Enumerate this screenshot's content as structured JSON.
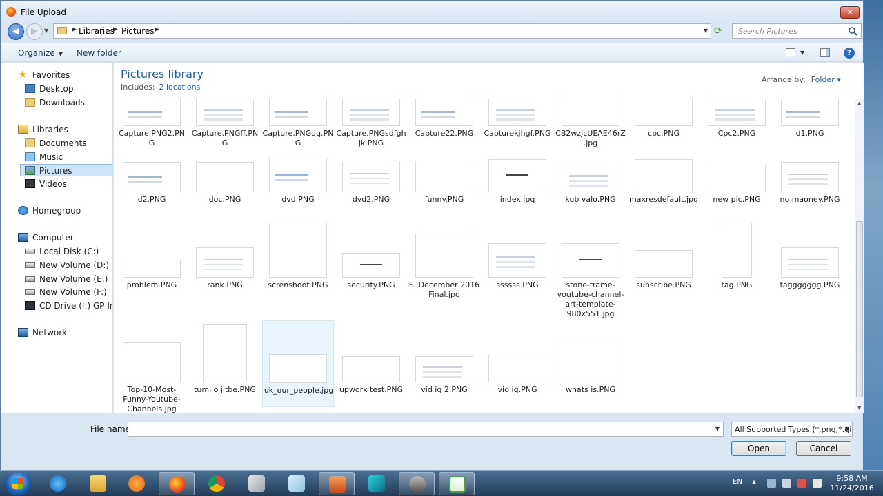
{
  "window": {
    "title": "File Upload",
    "close_label": "✕"
  },
  "address": {
    "crumbs": [
      "Libraries",
      "Pictures"
    ],
    "search_placeholder": "Search Pictures"
  },
  "toolbar": {
    "organize": "Organize",
    "new_folder": "New folder",
    "help": "?"
  },
  "nav": {
    "favorites": "Favorites",
    "desktop": "Desktop",
    "downloads": "Downloads",
    "libraries": "Libraries",
    "documents": "Documents",
    "music": "Music",
    "pictures": "Pictures",
    "videos": "Videos",
    "homegroup": "Homegroup",
    "computer": "Computer",
    "local_c": "Local Disk (C:)",
    "vol_d": "New Volume (D:)",
    "vol_e": "New Volume (E:)",
    "vol_f": "New Volume (F:)",
    "cd": "CD Drive (I:) GP Inter",
    "network": "Network"
  },
  "library": {
    "title": "Pictures library",
    "includes_label": "Includes:",
    "includes_link": "2 locations",
    "arrange_label": "Arrange by:",
    "arrange_value": "Folder"
  },
  "files": [
    "Capture.PNG2.PNG",
    "Capture.PNGff.PNG",
    "Capture.PNGqq.PNG",
    "Capture.PNGsdfghjk.PNG",
    "Capture22.PNG",
    "Capturekjhgf.PNG",
    "CB2wzjcUEAE46rZ.jpg",
    "cpc.PNG",
    "Cpc2.PNG",
    "d1.PNG",
    "d2.PNG",
    "doc.PNG",
    "dvd.PNG",
    "dvd2.PNG",
    "funny.PNG",
    "index.jpg",
    "kub valo.PNG",
    "maxresdefault.jpg",
    "new pic.PNG",
    "no maoney.PNG",
    "problem.PNG",
    "rank.PNG",
    "screnshoot.PNG",
    "security.PNG",
    "SI December 2016 Final.jpg",
    "ssssss.PNG",
    "stone-frame-youtube-channel-art-template-980x551.jpg",
    "subscribe.PNG",
    "tag.PNG",
    "taggggggg.PNG",
    "Top-10-Most-Funny-Youtube-Channels.jpg",
    "tumi o jitbe.PNG",
    "uk_our_people.jpg",
    "upwork test.PNG",
    "vid iq 2.PNG",
    "vid iq.PNG",
    "whats is.PNG"
  ],
  "bottom": {
    "file_name_label": "File name:",
    "file_name_value": "",
    "type_value": "All Supported Types (*.png;*.gi",
    "open": "Open",
    "cancel": "Cancel"
  },
  "taskbar": {
    "lang": "EN",
    "time": "9:58 AM",
    "date": "11/24/2016"
  }
}
